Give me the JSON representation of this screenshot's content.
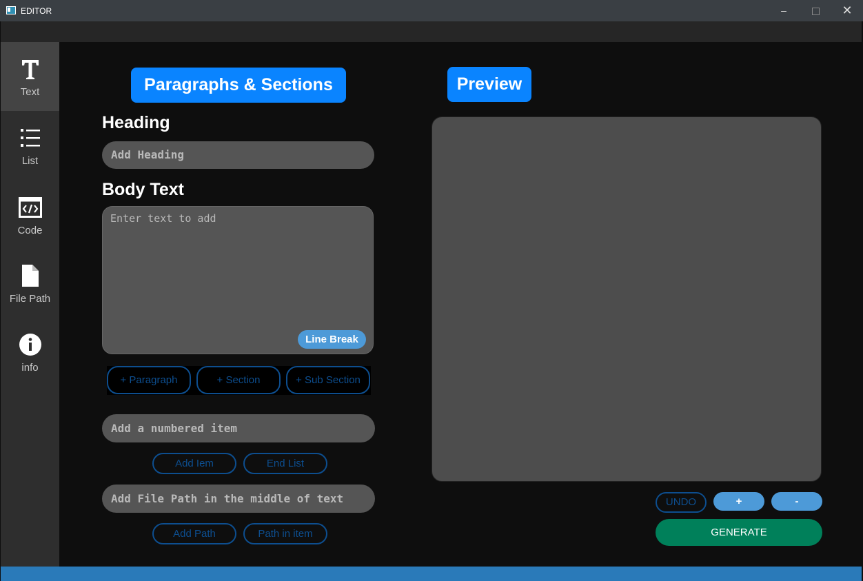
{
  "window": {
    "title": "EDITOR"
  },
  "sidebar": {
    "items": [
      {
        "label": "Text",
        "icon": "text-icon"
      },
      {
        "label": "List",
        "icon": "list-icon"
      },
      {
        "label": "Code",
        "icon": "code-icon"
      },
      {
        "label": "File Path",
        "icon": "file-icon"
      },
      {
        "label": "info",
        "icon": "info-icon"
      }
    ]
  },
  "editor": {
    "section_title": "Paragraphs & Sections",
    "heading_label": "Heading",
    "heading_placeholder": "Add Heading",
    "body_label": "Body Text",
    "body_placeholder": "Enter text to add",
    "line_break": "Line Break",
    "add_paragraph": "+ Paragraph",
    "add_section": "+ Section",
    "add_subsection": "+ Sub Section",
    "numbered_placeholder": "Add a numbered item",
    "add_item": "Add Iem",
    "end_list": "End List",
    "filepath_placeholder": "Add File Path in the middle of text",
    "add_path": "Add Path",
    "path_in_item": "Path in item"
  },
  "preview": {
    "title": "Preview",
    "undo": "UNDO",
    "zoom_in": "+",
    "zoom_out": "-",
    "generate": "GENERATE"
  },
  "colors": {
    "accent": "#0a84ff",
    "generate": "#00805a",
    "statusbar": "#2a7ab9"
  }
}
